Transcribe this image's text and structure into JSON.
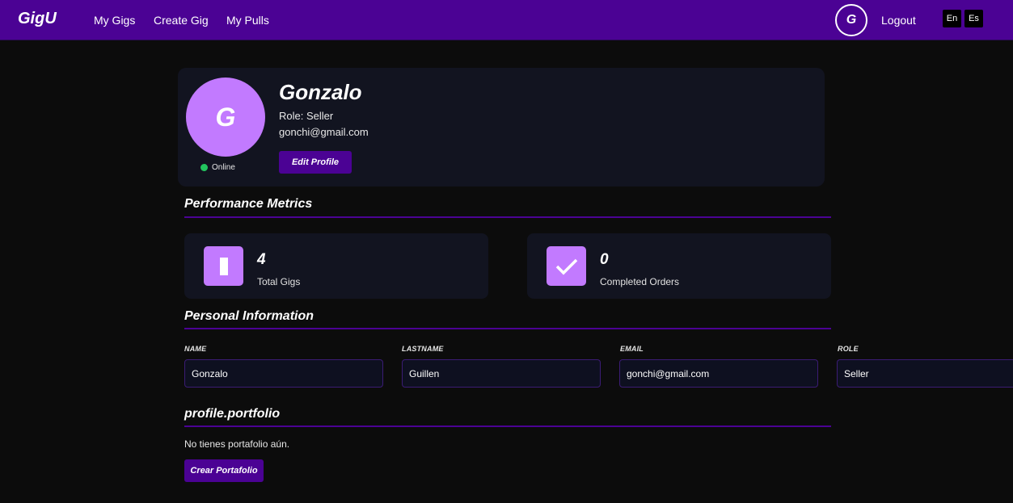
{
  "navbar": {
    "brand": "GigU",
    "links": [
      "My Gigs",
      "Create Gig",
      "My Pulls"
    ],
    "avatar_initial": "G",
    "logout": "Logout",
    "languages": [
      "En",
      "Es"
    ]
  },
  "profile": {
    "avatar_initial": "G",
    "status": "Online",
    "name": "Gonzalo",
    "role": "Role: Seller",
    "email": "gonchi@gmail.com",
    "edit_button": "Edit Profile"
  },
  "metrics": {
    "title": "Performance Metrics",
    "items": [
      {
        "value": "4",
        "label": "Total Gigs",
        "icon": "gig-icon"
      },
      {
        "value": "0",
        "label": "Completed Orders",
        "icon": "check-icon"
      }
    ]
  },
  "personal_info": {
    "title": "Personal Information",
    "fields": [
      {
        "label": "NAME",
        "value": "Gonzalo"
      },
      {
        "label": "LASTNAME",
        "value": "Guillen"
      },
      {
        "label": "EMAIL",
        "value": "gonchi@gmail.com"
      },
      {
        "label": "ROLE",
        "value": "Seller"
      }
    ]
  },
  "portfolio": {
    "title": "profile.portfolio",
    "empty_text": "No tienes portafolio aún.",
    "create_button": "Crear Portafolio"
  },
  "colors": {
    "primary": "#4b0294",
    "accent": "#c27aff",
    "card": "#121420",
    "background": "#0c0c0c",
    "online": "#22c55e"
  }
}
